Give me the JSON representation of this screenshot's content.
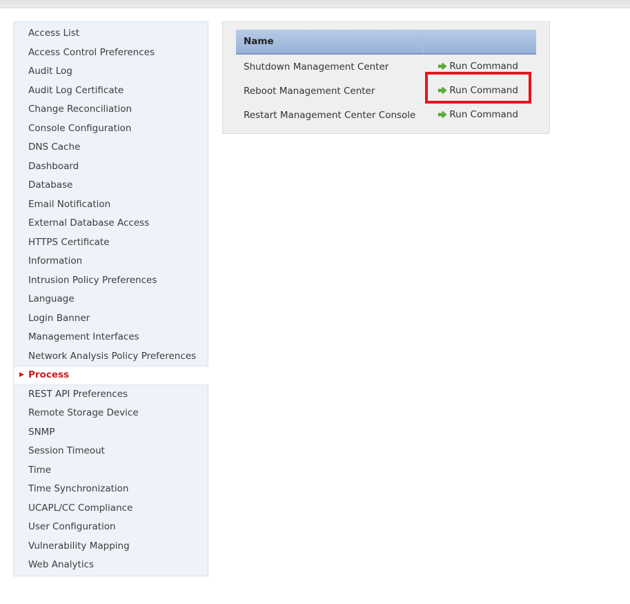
{
  "sidebar": {
    "items": [
      {
        "label": "Access List"
      },
      {
        "label": "Access Control Preferences"
      },
      {
        "label": "Audit Log"
      },
      {
        "label": "Audit Log Certificate"
      },
      {
        "label": "Change Reconciliation"
      },
      {
        "label": "Console Configuration"
      },
      {
        "label": "DNS Cache"
      },
      {
        "label": "Dashboard"
      },
      {
        "label": "Database"
      },
      {
        "label": "Email Notification"
      },
      {
        "label": "External Database Access"
      },
      {
        "label": "HTTPS Certificate"
      },
      {
        "label": "Information"
      },
      {
        "label": "Intrusion Policy Preferences"
      },
      {
        "label": "Language"
      },
      {
        "label": "Login Banner"
      },
      {
        "label": "Management Interfaces"
      },
      {
        "label": "Network Analysis Policy Preferences"
      },
      {
        "label": "Process",
        "active": true
      },
      {
        "label": "REST API Preferences"
      },
      {
        "label": "Remote Storage Device"
      },
      {
        "label": "SNMP"
      },
      {
        "label": "Session Timeout"
      },
      {
        "label": "Time"
      },
      {
        "label": "Time Synchronization"
      },
      {
        "label": "UCAPL/CC Compliance"
      },
      {
        "label": "User Configuration"
      },
      {
        "label": "Vulnerability Mapping"
      },
      {
        "label": "Web Analytics"
      }
    ],
    "active_marker": "▶"
  },
  "process_table": {
    "columns": [
      "Name",
      ""
    ],
    "rows": [
      {
        "name": "Shutdown Management Center",
        "action": "Run Command",
        "highlighted": false
      },
      {
        "name": "Reboot Management Center",
        "action": "Run Command",
        "highlighted": true
      },
      {
        "name": "Restart Management Center Console",
        "action": "Run Command",
        "highlighted": false
      }
    ]
  },
  "colors": {
    "active_item": "#cc1a1a",
    "highlight_box": "#e8141c",
    "run_arrow": "#5aae3a",
    "header_bg": "#a8bfe0"
  }
}
